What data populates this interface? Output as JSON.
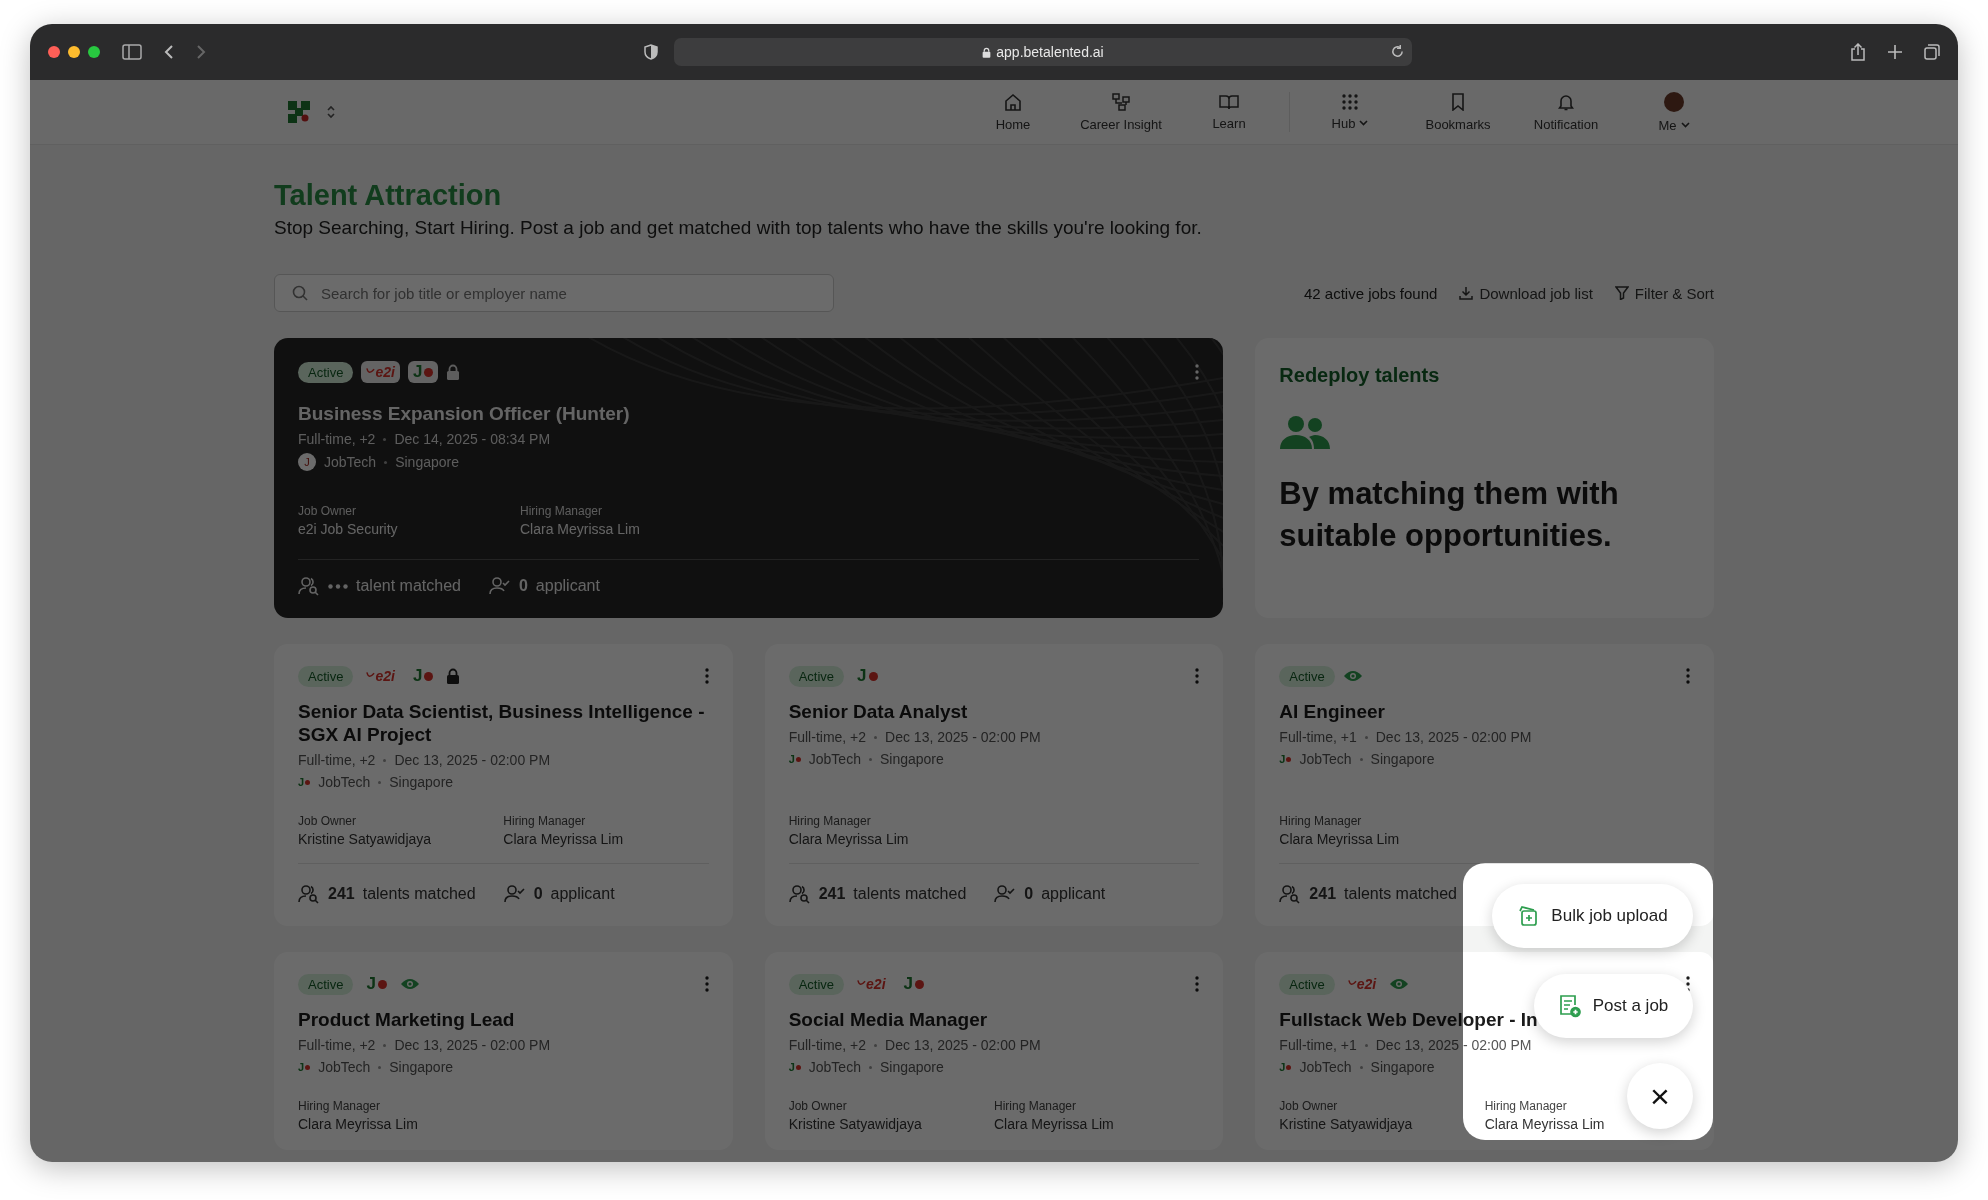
{
  "browser": {
    "url": "app.betalented.ai"
  },
  "nav": {
    "items": [
      {
        "label": "Home",
        "dropdown": false
      },
      {
        "label": "Career Insight",
        "dropdown": false
      },
      {
        "label": "Learn",
        "dropdown": false
      },
      {
        "label": "Hub",
        "dropdown": true
      },
      {
        "label": "Bookmarks",
        "dropdown": false
      },
      {
        "label": "Notification",
        "dropdown": false
      },
      {
        "label": "Me",
        "dropdown": true
      }
    ]
  },
  "header": {
    "title": "Talent Attraction",
    "subtitle": "Stop Searching, Start Hiring. Post a job and get matched with top talents who have the skills you're looking for."
  },
  "toolbar": {
    "search_placeholder": "Search for job title or employer name",
    "job_count": "42 active jobs found",
    "actions": [
      {
        "kind": "download",
        "label": "Download job list"
      },
      {
        "kind": "filter",
        "label": "Filter & Sort"
      }
    ]
  },
  "featured_job": {
    "status": "Active",
    "badges": [
      {
        "kind": "e2i",
        "label": "e2i"
      },
      {
        "kind": "jobtech",
        "label": "J"
      }
    ],
    "locked": true,
    "title": "Business Expansion Officer (Hunter)",
    "type": "Full-time, +2",
    "date": "Dec 14, 2025 - 08:34 PM",
    "company_initial": "J",
    "company": "JobTech",
    "location": "Singapore",
    "owner_label": "Job Owner",
    "owner": "e2i Job Security",
    "manager_label": "Hiring Manager",
    "manager": "Clara Meyrissa Lim",
    "talents": {
      "loading": true,
      "label": "talent matched"
    },
    "applicants": {
      "count": "0",
      "label": "applicant"
    }
  },
  "redeploy": {
    "title": "Redeploy talents",
    "text": "By matching them with suitable opportunities."
  },
  "jobs": [
    {
      "status": "Active",
      "badges": [
        {
          "kind": "e2i",
          "label": "e2i"
        },
        {
          "kind": "jobtech",
          "label": "J"
        }
      ],
      "locked": true,
      "title": "Senior Data Scientist, Business Intelligence - SGX AI Project",
      "type": "Full-time, +2",
      "date": "Dec 13, 2025 - 02:00 PM",
      "company_initial": "J",
      "company": "JobTech",
      "location": "Singapore",
      "owner_label": "Job Owner",
      "owner": "Kristine Satyawidjaya",
      "manager_label": "Hiring Manager",
      "manager": "Clara Meyrissa Lim",
      "talents": {
        "loading": false,
        "count": "241",
        "label": "talents matched"
      },
      "applicants": {
        "count": "0",
        "label": "applicant"
      }
    },
    {
      "status": "Active",
      "badges": [
        {
          "kind": "jobtech",
          "label": "J"
        }
      ],
      "title": "Senior Data Analyst",
      "type": "Full-time, +2",
      "date": "Dec 13, 2025 - 02:00 PM",
      "company_initial": "J",
      "company": "JobTech",
      "location": "Singapore",
      "manager_label": "Hiring Manager",
      "manager": "Clara Meyrissa Lim",
      "talents": {
        "loading": false,
        "count": "241",
        "label": "talents matched"
      },
      "applicants": {
        "count": "0",
        "label": "applicant"
      }
    },
    {
      "status": "Active",
      "visible": true,
      "title": "AI Engineer",
      "type": "Full-time, +1",
      "date": "Dec 13, 2025 - 02:00 PM",
      "company_initial": "J",
      "company": "JobTech",
      "location": "Singapore",
      "manager_label": "Hiring Manager",
      "manager": "Clara Meyrissa Lim",
      "talents": {
        "loading": false,
        "count": "241",
        "label": "talents matched"
      }
    },
    {
      "status": "Active",
      "badges": [
        {
          "kind": "jobtech",
          "label": "J"
        }
      ],
      "visible": true,
      "title": "Product Marketing Lead",
      "type": "Full-time, +2",
      "date": "Dec 13, 2025 - 02:00 PM",
      "company_initial": "J",
      "company": "JobTech",
      "location": "Singapore",
      "manager_label": "Hiring Manager",
      "manager": "Clara Meyrissa Lim"
    },
    {
      "status": "Active",
      "badges": [
        {
          "kind": "e2i",
          "label": "e2i"
        },
        {
          "kind": "jobtech",
          "label": "J"
        }
      ],
      "title": "Social Media Manager",
      "type": "Full-time, +2",
      "date": "Dec 13, 2025 - 02:00 PM",
      "company_initial": "J",
      "company": "JobTech",
      "location": "Singapore",
      "owner_label": "Job Owner",
      "owner": "Kristine Satyawidjaya",
      "manager_label": "Hiring Manager",
      "manager": "Clara Meyrissa Lim"
    },
    {
      "status": "Active",
      "badges": [
        {
          "kind": "e2i",
          "label": "e2i"
        }
      ],
      "visible": true,
      "title": "Fullstack Web Developer - In",
      "type": "Full-time, +1",
      "date": "Dec 13, 2025 - 02:00 PM",
      "company_initial": "J",
      "company": "JobTech",
      "location": "Singapore",
      "owner_label": "Job Owner",
      "owner": "Kristine Satyawidjaya",
      "manager_label": "Hiring Manager",
      "manager": "Clara Meyrissa Lim"
    }
  ],
  "fab_menu": {
    "items": [
      {
        "kind": "bulk",
        "label": "Bulk job upload"
      },
      {
        "kind": "post",
        "label": "Post a job"
      }
    ],
    "close": "×"
  }
}
